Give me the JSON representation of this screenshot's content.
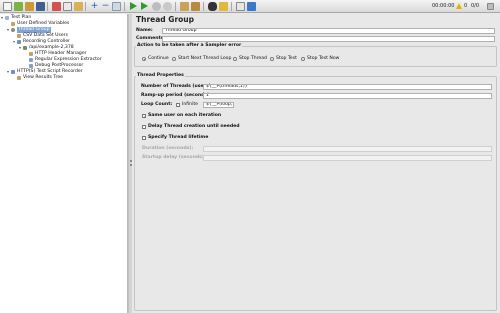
{
  "toolbar": {
    "timer": "00:00:00",
    "warnings": "0",
    "counts": "0/0"
  },
  "tree": {
    "items": [
      {
        "label": "Test Plan",
        "icon": "test-plan-icon"
      },
      {
        "label": "User Defined Variables",
        "icon": "variables-icon"
      },
      {
        "label": "Thread Group",
        "icon": "thread-group-icon"
      },
      {
        "label": "CSV Data Set Users",
        "icon": "csv-icon"
      },
      {
        "label": "Recording Controller",
        "icon": "controller-icon"
      },
      {
        "label": "/api/example-2,378",
        "icon": "sampler-icon"
      },
      {
        "label": "HTTP Header Manager",
        "icon": "header-manager-icon"
      },
      {
        "label": "Regular Expression Extractor",
        "icon": "extractor-icon"
      },
      {
        "label": "Debug PostProcessor",
        "icon": "debug-icon"
      },
      {
        "label": "HTTP(S) Test Script Recorder",
        "icon": "recorder-icon"
      },
      {
        "label": "View Results Tree",
        "icon": "results-tree-icon"
      }
    ]
  },
  "panel": {
    "title": "Thread Group",
    "name_label": "Name:",
    "name_value": "Thread Group",
    "comments_label": "Comments:",
    "comments_value": "",
    "error_group_title": "Action to be taken after a Sampler error",
    "error_options": [
      "Continue",
      "Start Next Thread Loop",
      "Stop Thread",
      "Stop Test",
      "Stop Test Now"
    ],
    "error_selected": "Continue",
    "props_title": "Thread Properties",
    "threads_label": "Number of Threads (users):",
    "threads_value": "${__P(threads,1)}",
    "rampup_label": "Ramp-up period (seconds):",
    "rampup_value": "1",
    "loop_label": "Loop Count:",
    "infinite_label": "Infinite",
    "loop_value": "${__P(loop,1)}",
    "same_user_label": "Same user on each iteration",
    "delay_label": "Delay Thread creation until needed",
    "lifetime_label": "Specify Thread lifetime",
    "duration_label": "Duration (seconds):",
    "startup_label": "Startup delay (seconds):"
  }
}
